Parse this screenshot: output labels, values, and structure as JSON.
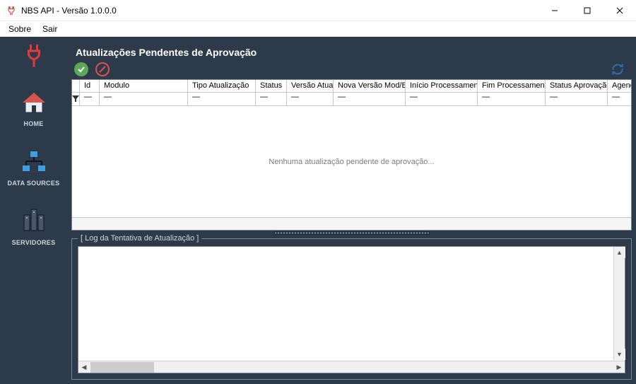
{
  "window": {
    "title": "NBS API - Versão 1.0.0.0"
  },
  "menu": {
    "items": [
      "Sobre",
      "Sair"
    ]
  },
  "sidebar": {
    "items": [
      {
        "id": "home",
        "label": "HOME"
      },
      {
        "id": "datasources",
        "label": "DATA SOURCES"
      },
      {
        "id": "servidores",
        "label": "SERVIDORES"
      }
    ]
  },
  "panel": {
    "title": "Atualizações Pendentes de Aprovação",
    "empty_message": "Nenhuma atualização pendente de aprovação...",
    "columns": [
      {
        "label": "Id",
        "width": 28
      },
      {
        "label": "Modulo",
        "width": 125
      },
      {
        "label": "Tipo Atualização",
        "width": 96
      },
      {
        "label": "Status",
        "width": 44
      },
      {
        "label": "Versão Atual",
        "width": 66
      },
      {
        "label": "Nova Versão Mod/Bd",
        "width": 102
      },
      {
        "label": "Início Processamento",
        "width": 102
      },
      {
        "label": "Fim Processamento",
        "width": 96
      },
      {
        "label": "Status Aprovação",
        "width": 88
      },
      {
        "label": "Agendado pelo Aprov.",
        "width": 120
      }
    ],
    "filter_placeholder": "﹀"
  },
  "log": {
    "legend": "[ Log da Tentativa de Atualização ]",
    "content": ""
  },
  "icons": {
    "approve": "approve-icon",
    "reject": "reject-icon",
    "refresh": "refresh-icon"
  }
}
